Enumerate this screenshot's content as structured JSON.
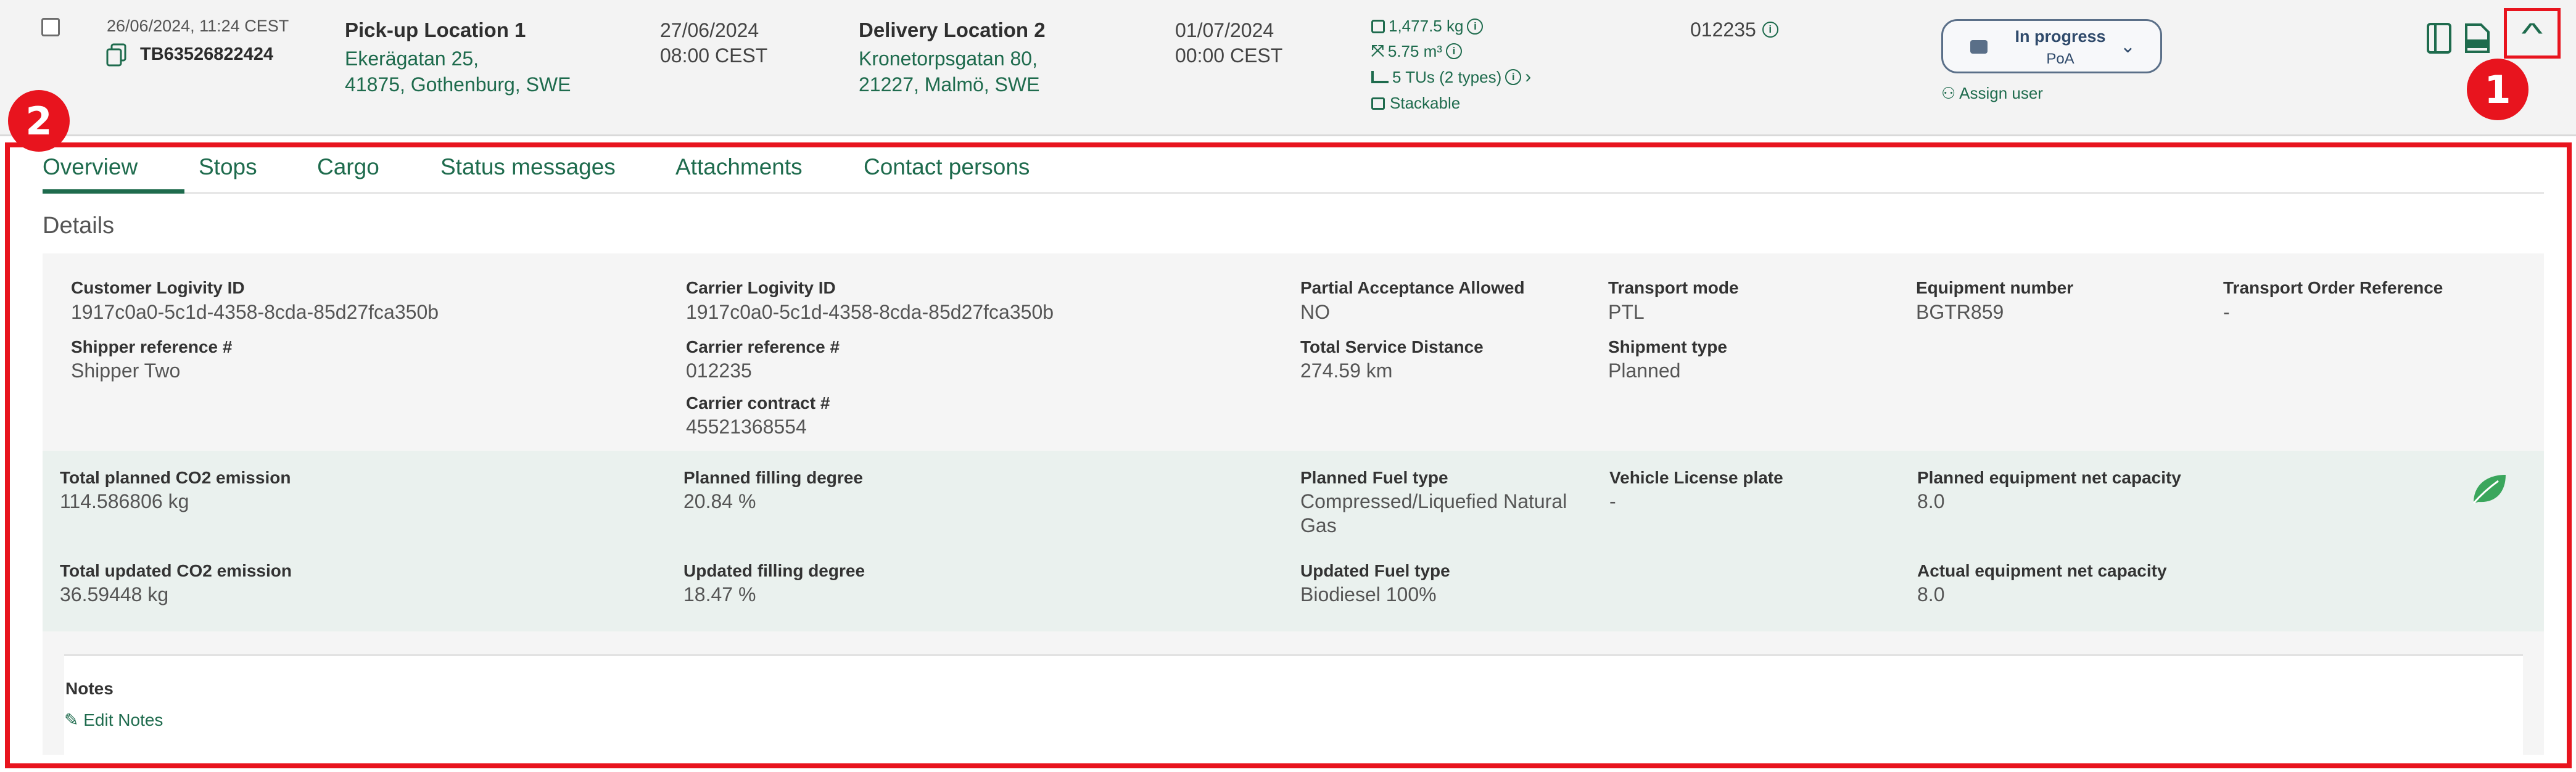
{
  "shipment": {
    "created": "26/06/2024, 11:24 CEST",
    "reference": "TB63526822424",
    "pickup": {
      "name": "Pick-up Location 1",
      "street": "Ekerägatan 25,",
      "city": "41875, Gothenburg, SWE",
      "date": "27/06/2024",
      "time": "08:00 CEST"
    },
    "delivery": {
      "name": "Delivery Location 2",
      "street": "Kronetorpsgatan 80,",
      "city": "21227, Malmö, SWE",
      "date": "01/07/2024",
      "time": "00:00 CEST"
    },
    "cargo": {
      "weight": "1,477.5 kg",
      "volume": "5.75 m³",
      "tus": "5 TUs (2 types)",
      "stackable": "Stackable"
    },
    "carrier_ref": "012235",
    "status": {
      "title": "In progress",
      "sub": "PoA",
      "assign": "Assign user"
    }
  },
  "annotations": {
    "badge1": "1",
    "badge2": "2"
  },
  "tabs": [
    "Overview",
    "Stops",
    "Cargo",
    "Status messages",
    "Attachments",
    "Contact persons"
  ],
  "details": {
    "title": "Details",
    "customer_id_label": "Customer Logivity ID",
    "customer_id": "1917c0a0-5c1d-4358-8cda-85d27fca350b",
    "carrier_id_label": "Carrier Logivity ID",
    "carrier_id": "1917c0a0-5c1d-4358-8cda-85d27fca350b",
    "partial_label": "Partial Acceptance Allowed",
    "partial": "NO",
    "mode_label": "Transport mode",
    "mode": "PTL",
    "equipment_label": "Equipment number",
    "equipment": "BGTR859",
    "tor_label": "Transport Order Reference",
    "tor": "-",
    "shipper_ref_label": "Shipper reference #",
    "shipper_ref": "Shipper Two",
    "carrier_ref_label": "Carrier reference #",
    "carrier_ref": "012235",
    "distance_label": "Total Service Distance",
    "distance": "274.59 km",
    "shipment_type_label": "Shipment type",
    "shipment_type": "Planned",
    "contract_label": "Carrier contract #",
    "contract": "45521368554"
  },
  "emissions": {
    "planned_co2_label": "Total planned CO2 emission",
    "planned_co2": "114.586806 kg",
    "planned_fill_label": "Planned filling degree",
    "planned_fill": "20.84 %",
    "planned_fuel_label": "Planned Fuel type",
    "planned_fuel_line1": "Compressed/Liquefied Natural",
    "planned_fuel_line2": "Gas",
    "plate_label": "Vehicle License plate",
    "plate": "-",
    "planned_cap_label": "Planned equipment net capacity",
    "planned_cap": "8.0",
    "updated_co2_label": "Total updated CO2 emission",
    "updated_co2": "36.59448 kg",
    "updated_fill_label": "Updated filling degree",
    "updated_fill": "18.47 %",
    "updated_fuel_label": "Updated Fuel type",
    "updated_fuel": "Biodiesel 100%",
    "actual_cap_label": "Actual equipment net capacity",
    "actual_cap": "8.0"
  },
  "notes": {
    "title": "Notes",
    "edit": "Edit Notes"
  },
  "colors": {
    "accent": "#1e6b4d",
    "highlight": "#e8141e",
    "status": "#2f4a6b"
  },
  "icons": [
    "copy-icon",
    "weight-icon",
    "volume-icon",
    "pallet-icon",
    "stack-icon",
    "truck-icon",
    "user-icon",
    "document-icon",
    "pdf-icon",
    "chevron-up-icon",
    "leaf-icon",
    "edit-icon",
    "info-icon"
  ]
}
